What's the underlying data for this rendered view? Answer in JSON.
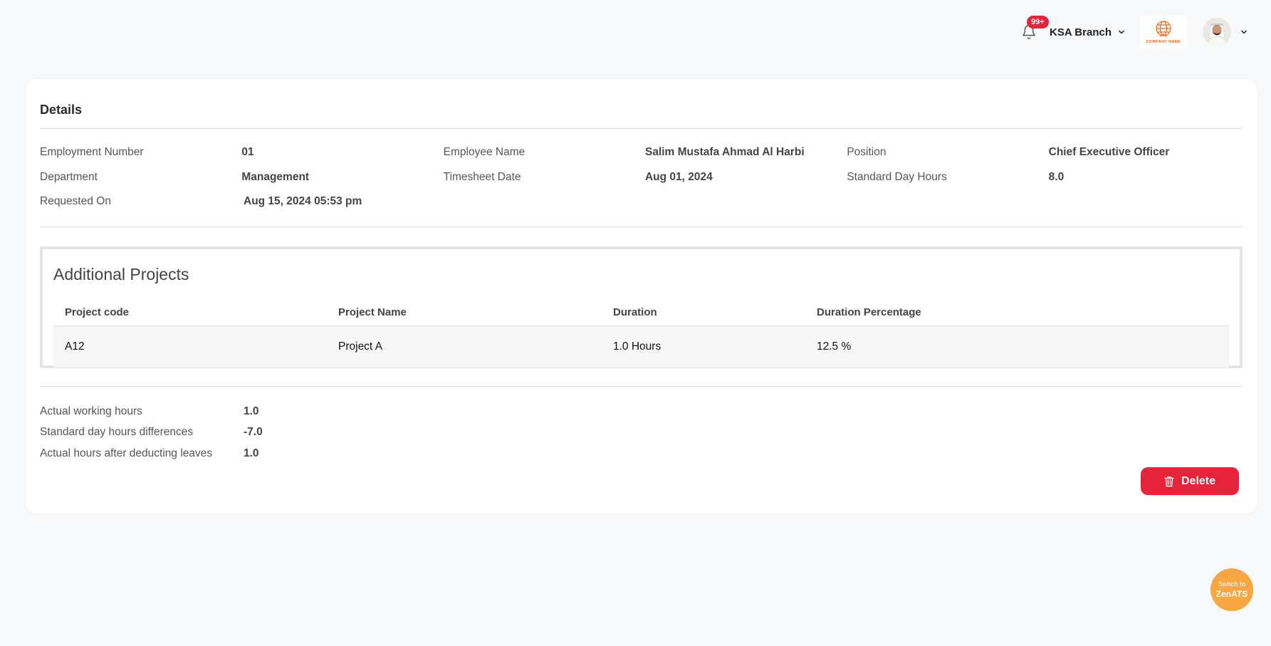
{
  "header": {
    "notification_count": "99+",
    "branch": "KSA Branch",
    "company_logo_text": "COMPANY NAME"
  },
  "details": {
    "title": "Details",
    "rows": [
      [
        {
          "label": "Employment Number",
          "value": "01"
        },
        {
          "label": "Employee Name",
          "value": "Salim Mustafa Ahmad Al Harbi"
        },
        {
          "label": "Position",
          "value": "Chief Executive Officer"
        }
      ],
      [
        {
          "label": "Department",
          "value": "Management"
        },
        {
          "label": "Timesheet Date",
          "value": "Aug 01, 2024"
        },
        {
          "label": "Standard Day Hours",
          "value": "8.0"
        }
      ],
      [
        {
          "label": "Requested On",
          "value": "Aug 15, 2024 05:53 pm"
        }
      ]
    ]
  },
  "projects": {
    "title": "Additional Projects",
    "columns": [
      "Project code",
      "Project Name",
      "Duration",
      "Duration Percentage"
    ],
    "rows": [
      [
        "A12",
        "Project A",
        "1.0 Hours",
        "12.5 %"
      ]
    ]
  },
  "summary": [
    {
      "label": "Actual working hours",
      "value": "1.0"
    },
    {
      "label": "Standard day hours differences",
      "value": "-7.0"
    },
    {
      "label": "Actual hours after deducting leaves",
      "value": "1.0"
    }
  ],
  "actions": {
    "delete_label": "Delete"
  },
  "switch": {
    "line1": "Switch to",
    "line2": "ZenATS"
  },
  "colors": {
    "danger": "#e5243b",
    "accent_orange": "#f7a641",
    "logo_orange": "#ef6b1f"
  }
}
